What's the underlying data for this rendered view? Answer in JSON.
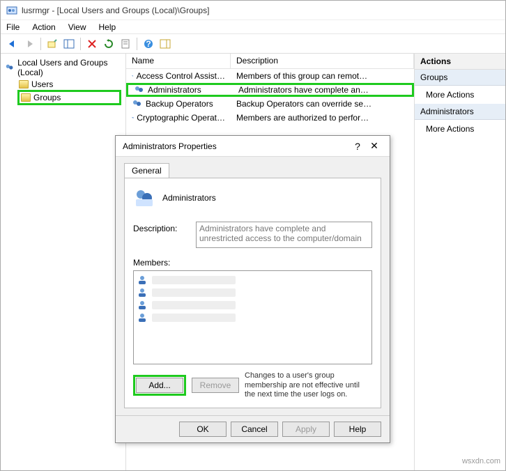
{
  "titlebar": {
    "title": "lusrmgr - [Local Users and Groups (Local)\\Groups]"
  },
  "menubar": {
    "file": "File",
    "action": "Action",
    "view": "View",
    "help": "Help"
  },
  "tree": {
    "root": "Local Users and Groups (Local)",
    "users": "Users",
    "groups": "Groups"
  },
  "list": {
    "col_name": "Name",
    "col_desc": "Description",
    "rows": [
      {
        "name": "Access Control Assist…",
        "desc": "Members of this group can remot…"
      },
      {
        "name": "Administrators",
        "desc": "Administrators have complete an…"
      },
      {
        "name": "Backup Operators",
        "desc": "Backup Operators can override se…"
      },
      {
        "name": "Cryptographic Operat…",
        "desc": "Members are authorized to perfor…"
      }
    ]
  },
  "actions": {
    "header": "Actions",
    "section1": "Groups",
    "more1": "More Actions",
    "section2": "Administrators",
    "more2": "More Actions"
  },
  "dialog": {
    "title": "Administrators Properties",
    "tab": "General",
    "group_name": "Administrators",
    "desc_label": "Description:",
    "desc_value": "Administrators have complete and unrestricted access to the computer/domain",
    "members_label": "Members:",
    "add": "Add...",
    "remove": "Remove",
    "note": "Changes to a user's group membership are not effective until the next time the user logs on.",
    "ok": "OK",
    "cancel": "Cancel",
    "apply": "Apply",
    "help": "Help"
  },
  "watermark": "wsxdn.com"
}
